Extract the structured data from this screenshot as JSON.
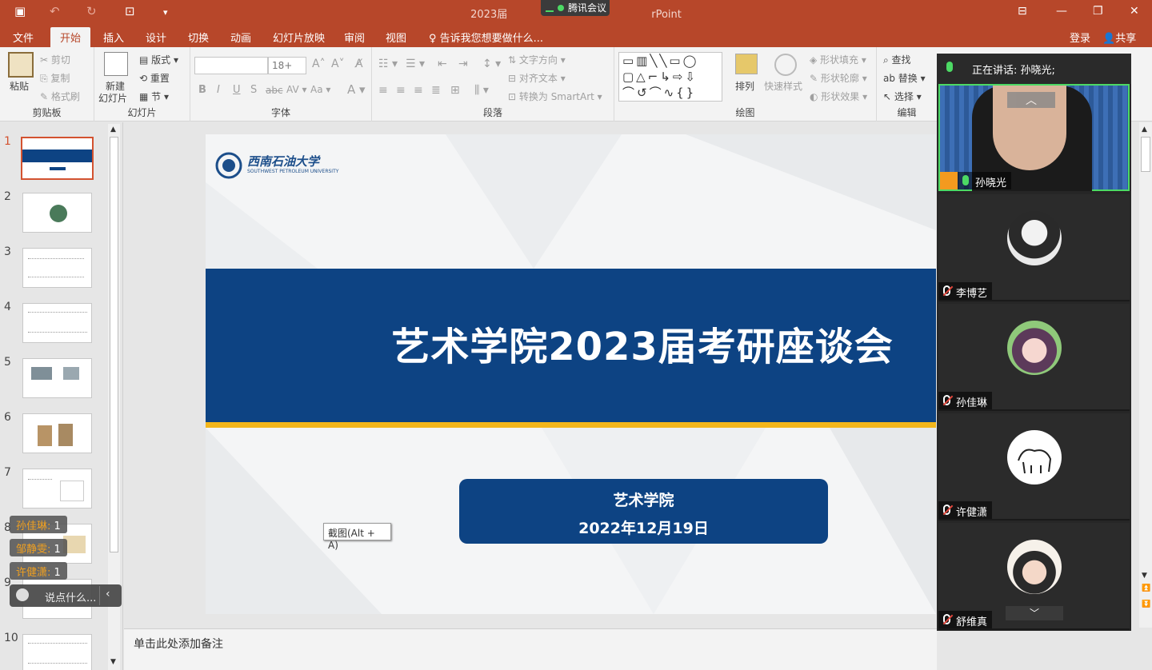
{
  "app": {
    "doc_title_left": "2023届",
    "doc_title_right": "rPoint",
    "meeting_pill": "腾讯会议"
  },
  "menu": {
    "tabs": [
      "文件",
      "开始",
      "插入",
      "设计",
      "切换",
      "动画",
      "幻灯片放映",
      "审阅",
      "视图"
    ],
    "tell_me": "告诉我您想要做什么...",
    "login": "登录",
    "share": "共享"
  },
  "ribbon": {
    "clipboard": {
      "paste": "粘贴",
      "cut": "剪切",
      "copy": "复制",
      "format_painter": "格式刷",
      "label": "剪贴板"
    },
    "slides": {
      "new_slide_line1": "新建",
      "new_slide_line2": "幻灯片",
      "layout": "版式",
      "reset": "重置",
      "section": "节",
      "label": "幻灯片"
    },
    "font": {
      "font_size": "18+",
      "label": "字体"
    },
    "paragraph": {
      "text_direction": "文字方向",
      "align_text": "对齐文本",
      "convert_smartart": "转换为 SmartArt",
      "label": "段落"
    },
    "drawing": {
      "arrange": "排列",
      "quick_styles": "快速样式",
      "shape_fill": "形状填充",
      "shape_outline": "形状轮廓",
      "shape_effects": "形状效果",
      "label": "绘图"
    },
    "editing": {
      "find": "查找",
      "replace": "替换",
      "select": "选择",
      "label": "编辑"
    }
  },
  "thumbnails": [
    "1",
    "2",
    "3",
    "4",
    "5",
    "6",
    "7",
    "8",
    "9",
    "10"
  ],
  "slide": {
    "title": "艺术学院2023届考研座谈会",
    "college": "艺术学院",
    "date": "2022年12月19日",
    "logo_cn": "西南石油大学",
    "logo_en": "SOUTHWEST PETROLEUM UNIVERSITY"
  },
  "tooltip": "截图(Alt + A)",
  "notes_placeholder": "单击此处添加备注",
  "meeting": {
    "speaking": "正在讲话: 孙晓光;",
    "participants": [
      {
        "name": "孙晓光",
        "mic": "on"
      },
      {
        "name": "李博艺",
        "mic": "off"
      },
      {
        "name": "孙佳琳",
        "mic": "off"
      },
      {
        "name": "许健潇",
        "mic": "off"
      },
      {
        "name": "舒维真",
        "mic": "off"
      }
    ]
  },
  "chat": {
    "messages": [
      {
        "name": "孙佳琳:",
        "text": "1"
      },
      {
        "name": "邹静雯:",
        "text": "1"
      },
      {
        "name": "许健潇:",
        "text": "1"
      }
    ],
    "input_placeholder": "说点什么..."
  }
}
